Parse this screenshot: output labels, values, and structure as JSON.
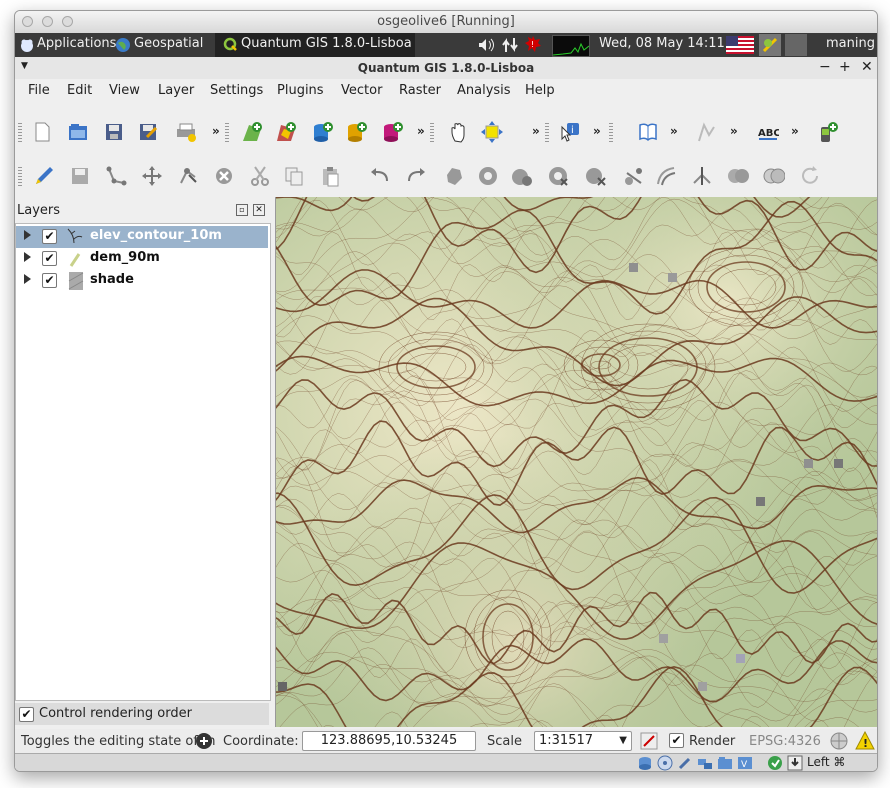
{
  "vbox": {
    "title": "osgeolive6 [Running]",
    "host_key": "Left ⌘"
  },
  "panel": {
    "applications": "Applications",
    "geospatial": "Geospatial",
    "task_title": "Quantum GIS 1.8.0-Lisboa",
    "clock": "Wed, 08 May  14:11",
    "user": "maning"
  },
  "window": {
    "title": "Quantum GIS 1.8.0-Lisboa"
  },
  "menu": [
    "File",
    "Edit",
    "View",
    "Layer",
    "Settings",
    "Plugins",
    "Vector",
    "Raster",
    "Analysis",
    "Help"
  ],
  "layers_panel": {
    "title": "Layers",
    "items": [
      {
        "name": "elev_contour_10m",
        "checked": true,
        "selected": true,
        "icon": "line-layer-icon"
      },
      {
        "name": "dem_90m",
        "checked": true,
        "selected": false,
        "icon": "raster-layer-icon"
      },
      {
        "name": "shade",
        "checked": true,
        "selected": false,
        "icon": "raster-gray-layer-icon"
      }
    ],
    "control_rendering_order": "Control rendering order"
  },
  "status": {
    "message": "Toggles the editing state of th",
    "coordinate_label": "Coordinate:",
    "coordinate_value": "123.88695,10.53245",
    "scale_label": "Scale",
    "scale_value": "1:31517",
    "render_label": "Render",
    "crs": "EPSG:4326"
  },
  "colors": {
    "panel_bg": "#3a3a3a",
    "selection": "#9ab3cc",
    "map_low": "#a9be8d",
    "map_high": "#e8e2c2",
    "contour": "#6b3a1e"
  }
}
